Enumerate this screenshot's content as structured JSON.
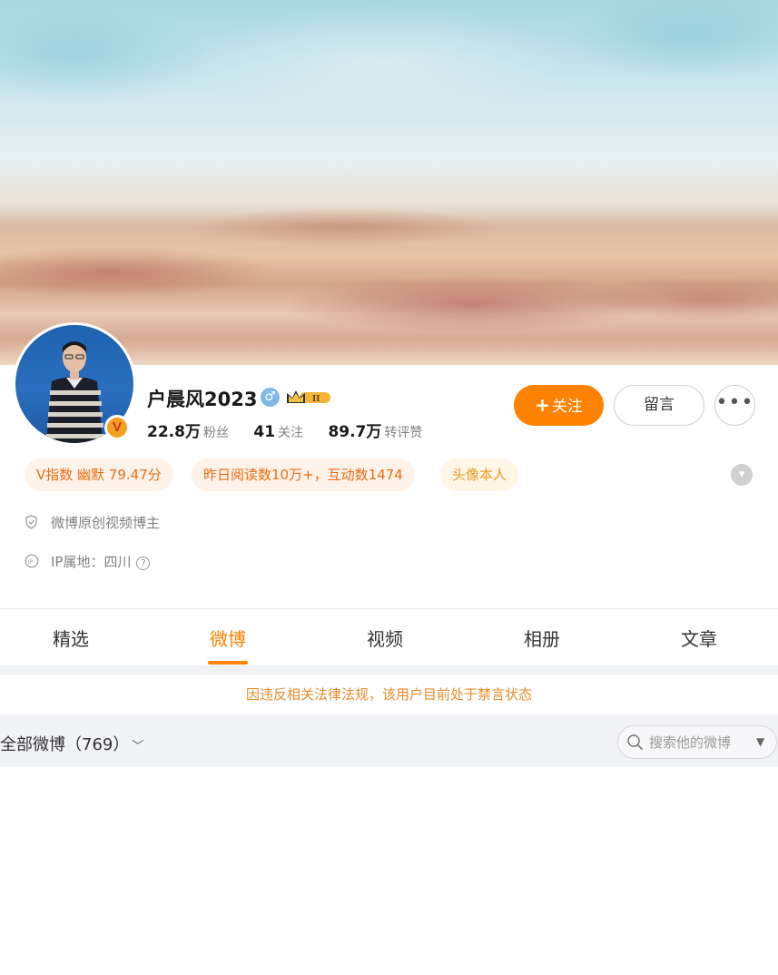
{
  "profile": {
    "name": "户晨风2023",
    "gender_symbol": "♂",
    "verified_symbol": "V",
    "stats": [
      {
        "value": "22.8万",
        "label": "粉丝"
      },
      {
        "value": "41",
        "label": "关注"
      },
      {
        "value": "89.7万",
        "label": "转评赞"
      }
    ]
  },
  "actions": {
    "follow_plus": "+",
    "follow_label": "关注",
    "message_label": "留言",
    "more_label": "•••"
  },
  "tags": [
    {
      "text": "V指数 幽默 79.47分"
    },
    {
      "text": "昨日阅读数10万+，互动数1474"
    },
    {
      "text": "头像本人"
    }
  ],
  "info": {
    "creator_line": "微博原创视频博主",
    "ip_line": "IP属地：四川",
    "ip_help": "?"
  },
  "tabs": [
    {
      "label": "精选",
      "active": false
    },
    {
      "label": "微博",
      "active": true
    },
    {
      "label": "视频",
      "active": false
    },
    {
      "label": "相册",
      "active": false
    },
    {
      "label": "文章",
      "active": false
    }
  ],
  "notice": "因违反相关法律法规，该用户目前处于禁言状态",
  "feed_filter": {
    "label": "全部微博（769）",
    "search_placeholder": "搜索他的微博"
  },
  "colors": {
    "accent": "#ff8200",
    "tag_text": "#ea6d15",
    "notice_text": "#e98b28"
  },
  "icons": {
    "shield": "shield-icon",
    "ip": "ip-location-icon",
    "search": "search-icon",
    "more": "more-dots-icon",
    "expand": "chevron-down-icon",
    "crown": "crown-vip-icon"
  }
}
